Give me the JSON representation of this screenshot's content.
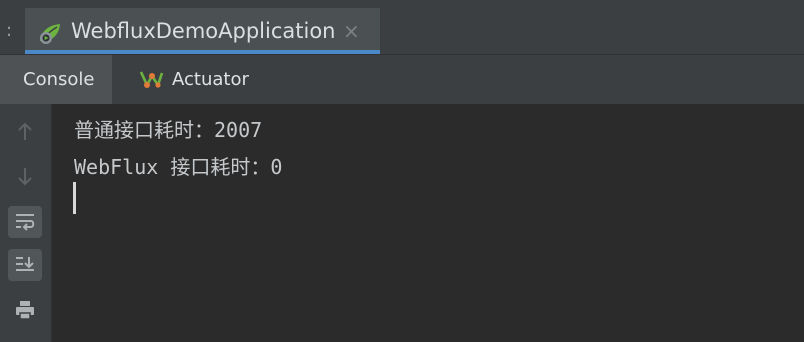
{
  "run_bar": {
    "overflow_glyph": ":",
    "tab_label": "WebfluxDemoApplication",
    "close_glyph": "×",
    "tab_icon": "spring-boot-run-icon"
  },
  "tool_tabs": [
    {
      "label": "Console",
      "active": true
    },
    {
      "label": "Actuator",
      "icon": "actuator-icon",
      "active": false
    }
  ],
  "toolbar": [
    {
      "icon": "up-arrow-icon",
      "enabled": false
    },
    {
      "icon": "down-arrow-icon",
      "enabled": false
    },
    {
      "icon": "soft-wrap-icon",
      "active": true
    },
    {
      "icon": "scroll-to-end-icon",
      "active": true
    },
    {
      "icon": "print-icon",
      "active": false
    }
  ],
  "console": {
    "lines": [
      "普通接口耗时：2007",
      "WebFlux 接口耗时：0"
    ]
  },
  "colors": {
    "background": "#2b2b2b",
    "panel": "#3c3f41",
    "selected_tab": "#4e5254",
    "accent_underline": "#4a88c7",
    "text": "#c6c9cc",
    "spring_green": "#6db33f"
  }
}
